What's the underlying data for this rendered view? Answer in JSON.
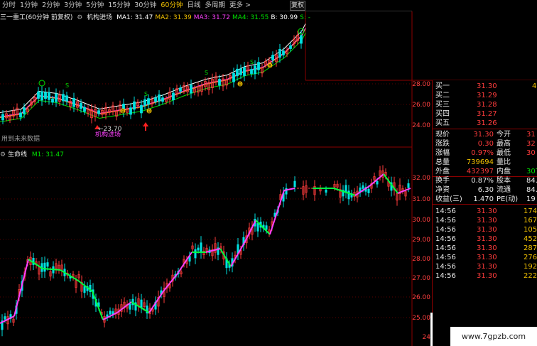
{
  "tabs": [
    "分时",
    "1分钟",
    "2分钟",
    "3分钟",
    "5分钟",
    "15分钟",
    "30分钟",
    "60分钟",
    "日线",
    "多周期",
    "更多 >"
  ],
  "active_tab": "60分钟",
  "fuquan_label": "复权",
  "upper_chart": {
    "title": "三一重工(60分钟 前复权)",
    "indicator_name": "机构进场",
    "ma": [
      {
        "label": "MA1: 31.47",
        "color": "#ffffff"
      },
      {
        "label": "MA2: 31.39",
        "color": "#f0c000"
      },
      {
        "label": "MA3: 31.72",
        "color": "#ff40ff"
      },
      {
        "label": "MA4: 31.55",
        "color": "#00e000"
      },
      {
        "label": "B: 30.99",
        "color": "#ffffff"
      },
      {
        "label": "S: -",
        "color": "#00e000"
      }
    ],
    "price_axis": [
      "28.00",
      "26.00",
      "24.00"
    ],
    "low_label": "←23.70",
    "signal_label": "机构进场",
    "future_label": "用到未来数据",
    "marker_b": "B",
    "marker_s": "S"
  },
  "lower_chart": {
    "title": "生命线",
    "m1": "M1: 31.47",
    "price_axis": [
      "32.00",
      "31.00",
      "30.00",
      "29.00",
      "28.00",
      "27.00",
      "26.00",
      "25.00",
      "24"
    ]
  },
  "quote_panel": {
    "bids": [
      {
        "label": "买一",
        "price": "31.30",
        "vol": "4"
      },
      {
        "label": "买二",
        "price": "31.29",
        "vol": ""
      },
      {
        "label": "买三",
        "price": "31.28",
        "vol": ""
      },
      {
        "label": "买四",
        "price": "31.27",
        "vol": ""
      },
      {
        "label": "买五",
        "price": "31.26",
        "vol": ""
      }
    ],
    "stats": [
      {
        "l1": "现价",
        "v1": "31.30",
        "l2": "今开",
        "v2": "31"
      },
      {
        "l1": "涨跌",
        "v1": "0.30",
        "l2": "最高",
        "v2": "32"
      },
      {
        "l1": "涨幅",
        "v1": "0.97%",
        "l2": "最低",
        "v2": "30"
      },
      {
        "l1": "总量",
        "v1": "739694",
        "l2": "量比",
        "v2": ""
      },
      {
        "l1": "外盘",
        "v1": "432397",
        "l2": "内盘",
        "v2": "307"
      },
      {
        "l1": "换手",
        "v1": "0.87%",
        "l2": "股本",
        "v2": "84."
      },
      {
        "l1": "净资",
        "v1": "6.30",
        "l2": "流通",
        "v2": "84."
      },
      {
        "l1": "收益(三)",
        "v1": "1.470",
        "l2": "PE(动)",
        "v2": "19"
      }
    ],
    "ticks": [
      {
        "time": "14:56",
        "price": "31.30",
        "vol": "174"
      },
      {
        "time": "14:56",
        "price": "31.30",
        "vol": "167"
      },
      {
        "time": "14:56",
        "price": "31.30",
        "vol": "105"
      },
      {
        "time": "14:56",
        "price": "31.30",
        "vol": "452"
      },
      {
        "time": "14:56",
        "price": "31.30",
        "vol": "287"
      },
      {
        "time": "14:56",
        "price": "31.30",
        "vol": "276"
      },
      {
        "time": "14:56",
        "price": "31.30",
        "vol": "192"
      },
      {
        "time": "14:56",
        "price": "31.30",
        "vol": "222"
      }
    ]
  },
  "watermark": "www.7gpzb.com"
}
